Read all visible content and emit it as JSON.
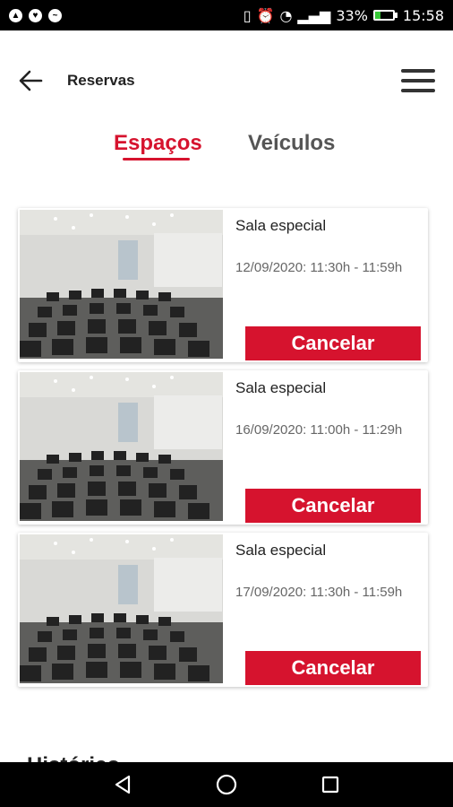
{
  "status_bar": {
    "left_icons": [
      "app-notification-icon",
      "heart-rate-icon",
      "messenger-icon"
    ],
    "battery_percent": "33%",
    "battery_level": 0.33,
    "time": "15:58"
  },
  "header": {
    "title": "Reservas",
    "back_icon": "back-arrow-icon",
    "menu_icon": "hamburger-menu-icon"
  },
  "tabs": [
    {
      "label": "Espaços",
      "active": true
    },
    {
      "label": "Veículos",
      "active": false
    }
  ],
  "reservations": [
    {
      "title": "Sala especial",
      "datetime": "12/09/2020: 11:30h - 11:59h",
      "action": "Cancelar"
    },
    {
      "title": "Sala especial",
      "datetime": "16/09/2020: 11:00h - 11:29h",
      "action": "Cancelar"
    },
    {
      "title": "Sala especial",
      "datetime": "17/09/2020: 11:30h - 11:59h",
      "action": "Cancelar"
    }
  ],
  "history_label": "Histórico",
  "colors": {
    "accent": "#d6132e",
    "text": "#222222",
    "muted": "#666666"
  }
}
